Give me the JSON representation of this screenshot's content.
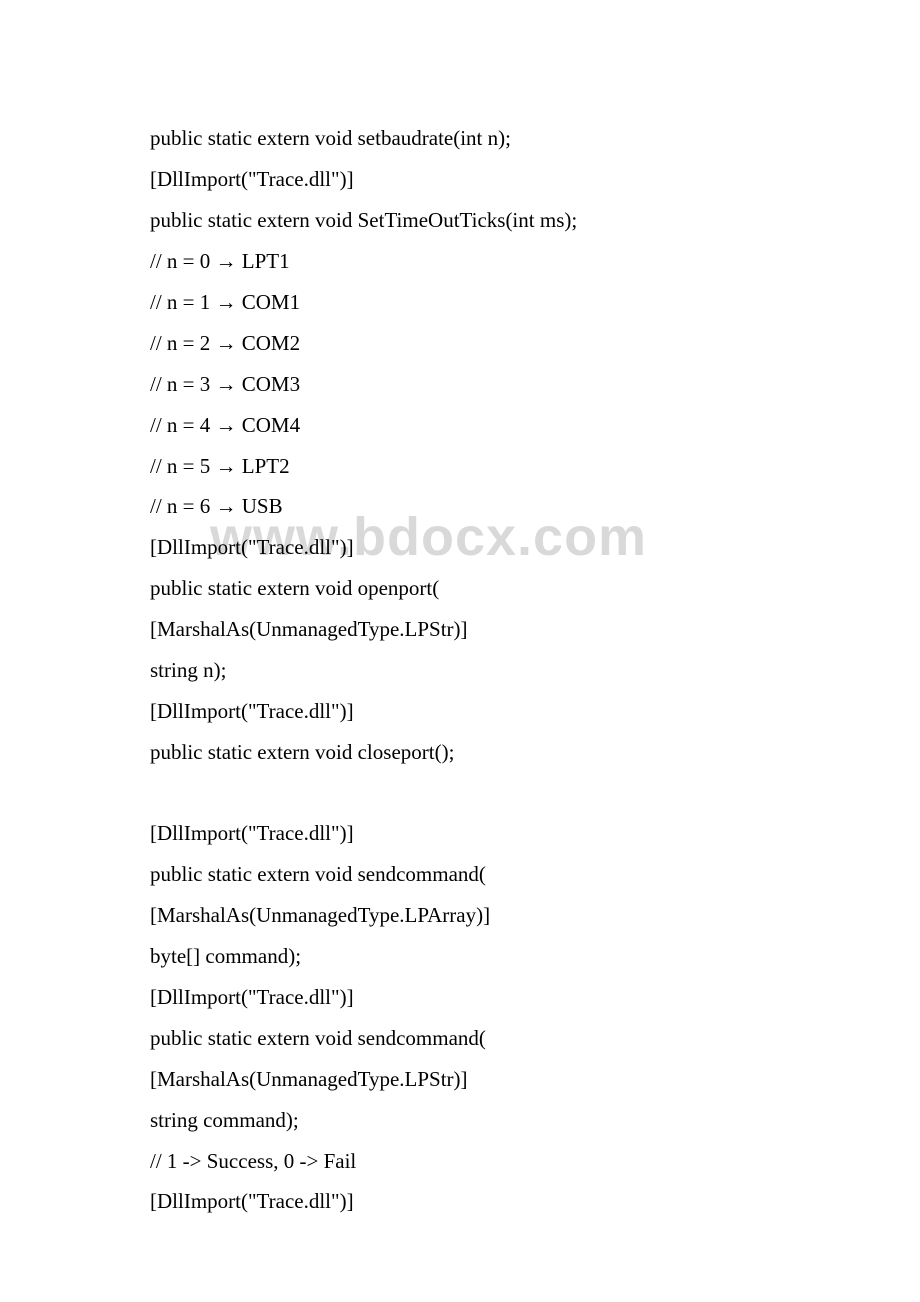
{
  "lines": {
    "l1": "public static extern void setbaudrate(int n);",
    "l2": "[DllImport(\"Trace.dll\")]",
    "l3": "public static extern void SetTimeOutTicks(int ms);",
    "l4": "// n = 0 → LPT1",
    "l5": "// n = 1 → COM1",
    "l6": "// n = 2 → COM2",
    "l7": "// n = 3 → COM3",
    "l8": "// n = 4 → COM4",
    "l9": "// n = 5 → LPT2",
    "l10": "// n = 6 → USB",
    "l11": "[DllImport(\"Trace.dll\")]",
    "l12": "public static extern void openport(",
    "l13": "[MarshalAs(UnmanagedType.LPStr)]",
    "l14": "string n);",
    "l15": "[DllImport(\"Trace.dll\")]",
    "l16": "public static extern void closeport();",
    "l17": "[DllImport(\"Trace.dll\")]",
    "l18": "public static extern void sendcommand(",
    "l19": "[MarshalAs(UnmanagedType.LPArray)]",
    "l20": "byte[] command);",
    "l21": "[DllImport(\"Trace.dll\")]",
    "l22": "public static extern void sendcommand(",
    "l23": "[MarshalAs(UnmanagedType.LPStr)]",
    "l24": "string command);",
    "l25": "// 1 -> Success, 0 -> Fail",
    "l26": "[DllImport(\"Trace.dll\")]"
  },
  "watermark": "www.bdocx.com"
}
